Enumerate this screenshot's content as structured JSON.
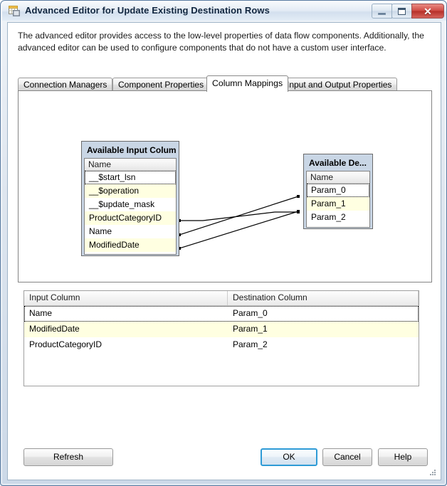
{
  "window": {
    "title": "Advanced Editor for Update Existing Destination Rows",
    "icon": "table-editor-icon",
    "minimize_label": "Minimize",
    "maximize_label": "Maximize",
    "close_label": "Close"
  },
  "description": "The advanced editor provides access to the low-level properties of data flow components. Additionally, the advanced editor can be used to configure components that do not have a custom user interface.",
  "tabs": [
    {
      "label": "Connection Managers",
      "selected": false
    },
    {
      "label": "Component Properties",
      "selected": false
    },
    {
      "label": "Column Mappings",
      "selected": true
    },
    {
      "label": "Input and Output Properties",
      "selected": false
    }
  ],
  "input_box": {
    "title": "Available Input Colum...",
    "header": "Name",
    "rows": [
      {
        "name": "__$start_lsn",
        "highlighted": false,
        "focused": true
      },
      {
        "name": "__$operation",
        "highlighted": true,
        "focused": false
      },
      {
        "name": "__$update_mask",
        "highlighted": false,
        "focused": false
      },
      {
        "name": "ProductCategoryID",
        "highlighted": true,
        "focused": false
      },
      {
        "name": "Name",
        "highlighted": false,
        "focused": false
      },
      {
        "name": "ModifiedDate",
        "highlighted": true,
        "focused": false
      }
    ]
  },
  "destination_box": {
    "title": "Available De...",
    "header": "Name",
    "rows": [
      {
        "name": "Param_0",
        "highlighted": false,
        "focused": true
      },
      {
        "name": "Param_1",
        "highlighted": true,
        "focused": false
      },
      {
        "name": "Param_2",
        "highlighted": false,
        "focused": false
      }
    ]
  },
  "mapping_grid": {
    "columns": [
      "Input Column",
      "Destination Column"
    ],
    "rows": [
      {
        "input": "Name",
        "destination": "Param_0",
        "highlighted": false,
        "focused": true
      },
      {
        "input": "ModifiedDate",
        "destination": "Param_1",
        "highlighted": true,
        "focused": false
      },
      {
        "input": "ProductCategoryID",
        "destination": "Param_2",
        "highlighted": false,
        "focused": false
      }
    ]
  },
  "buttons": {
    "refresh": "Refresh",
    "ok": "OK",
    "cancel": "Cancel",
    "help": "Help"
  },
  "colors": {
    "highlight_row": "#FFFFE1",
    "box_fill": "#C9D6E5",
    "default_button_border": "#2E9BD6",
    "close_button": "#CF4B44"
  }
}
